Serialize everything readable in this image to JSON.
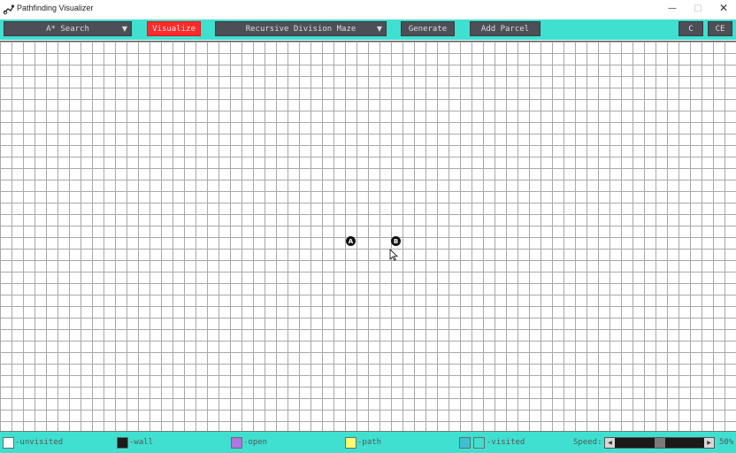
{
  "window": {
    "title": "Pathfinding Visualizer",
    "minimize_glyph": "—",
    "maximize_glyph": "□",
    "close_glyph": "✕"
  },
  "toolbar": {
    "algorithm": "A* Search",
    "visualize": "Visualize",
    "maze": "Recursive Division Maze",
    "generate": "Generate",
    "add_parcel": "Add Parcel",
    "clear": "C",
    "clear_everything": "CE",
    "dropdown_glyph": "▼",
    "button_color": "#4d4f56",
    "visualize_color": "#ff2a2a",
    "bar_color": "#40e0d0"
  },
  "grid": {
    "start_node_label": "A",
    "target_node_label": "B",
    "line_color": "#a9a9a9"
  },
  "legend": {
    "items": [
      {
        "label": "-unvisited",
        "color": "#ffffff"
      },
      {
        "label": "-wall",
        "color": "#1b1b1b"
      },
      {
        "label": "-open",
        "color": "#b174e0"
      },
      {
        "label": "-path",
        "color": "#ffff70"
      },
      {
        "label": "-visited",
        "colors": [
          "#3cc0d4",
          "#40e0d0"
        ]
      }
    ],
    "speed_label": "Speed:",
    "speed_value": "50%",
    "speed_fraction": 0.5
  }
}
